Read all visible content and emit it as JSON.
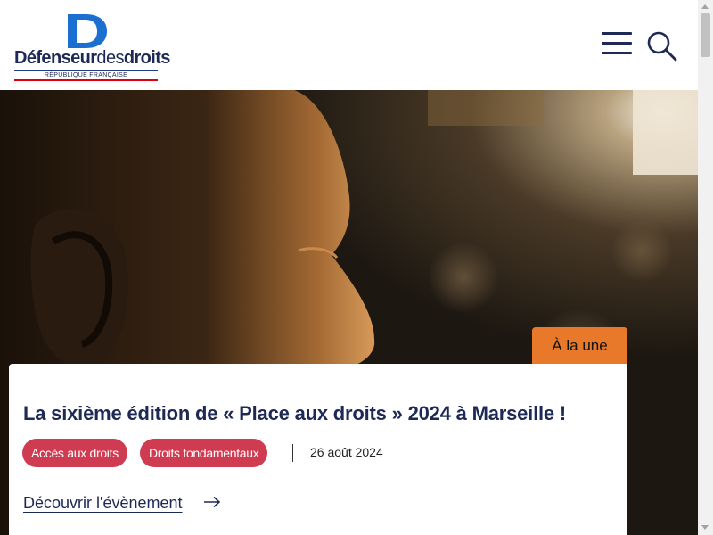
{
  "header": {
    "logo": {
      "letter": "D",
      "name_bold_1": "Défenseur",
      "name_light": "des",
      "name_bold_2": "droits",
      "subtitle": "RÉPUBLIQUE FRANÇAISE"
    },
    "menu_icon": "hamburger-menu-icon",
    "search_icon": "search-icon"
  },
  "colors": {
    "navy": "#1e2a55",
    "logo_blue": "#1b6fd1",
    "badge_orange": "#e8782a",
    "tag_red": "#cf3b51"
  },
  "featured": {
    "badge": "À la une",
    "title": "La sixième édition de « Place aux droits » 2024 à Marseille !",
    "tags": [
      "Accès aux droits",
      "Droits fondamentaux"
    ],
    "date": "26 août 2024",
    "cta": "Découvrir l'évènement",
    "cta_icon": "arrow-right-icon"
  }
}
